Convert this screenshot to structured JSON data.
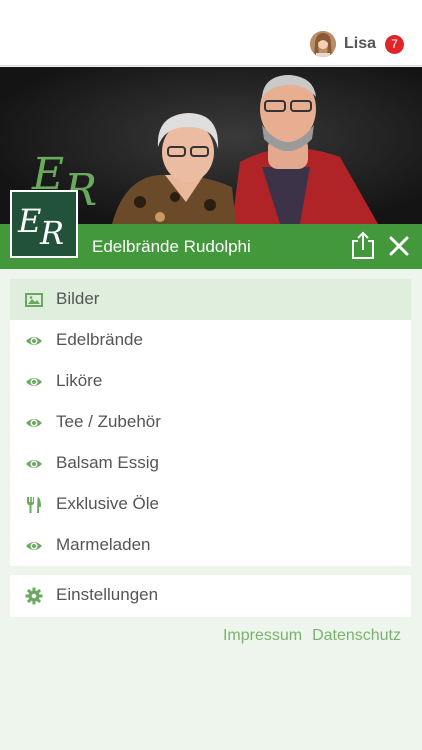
{
  "user": {
    "name": "Lisa",
    "notification_count": "7"
  },
  "app": {
    "title": "Edelbrände Rudolphi",
    "logo_text": "ER"
  },
  "menu": {
    "items": [
      {
        "label": "Bilder",
        "icon": "image-icon",
        "active": true
      },
      {
        "label": "Edelbrände",
        "icon": "eye-icon"
      },
      {
        "label": "Liköre",
        "icon": "eye-icon"
      },
      {
        "label": "Tee / Zubehör",
        "icon": "eye-icon"
      },
      {
        "label": "Balsam Essig",
        "icon": "eye-icon"
      },
      {
        "label": "Exklusive Öle",
        "icon": "cutlery-icon"
      },
      {
        "label": "Marmeladen",
        "icon": "eye-icon"
      }
    ]
  },
  "settings": {
    "label": "Einstellungen",
    "icon": "gear-icon"
  },
  "footer": {
    "impressum": "Impressum",
    "datenschutz": "Datenschutz"
  },
  "colors": {
    "brand_green": "#42983a",
    "logo_green": "#22533a",
    "badge_red": "#e0242a",
    "icon_green": "#6aaa5e"
  }
}
